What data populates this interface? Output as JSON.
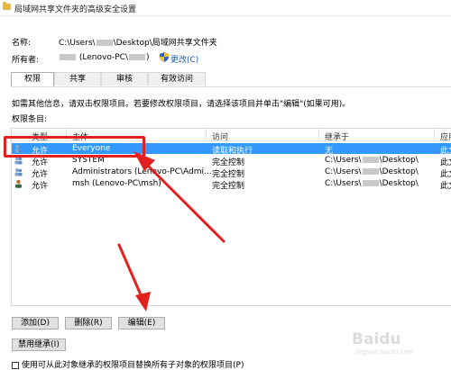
{
  "window": {
    "title": "局域网共享文件夹的高级安全设置"
  },
  "info": {
    "name_label": "名称:",
    "name_prefix": "C:\\Users\\",
    "name_suffix": "\\Desktop\\局域网共享文件夹",
    "owner_label": "所有者:",
    "owner_prefix": "(Lenovo-PC\\",
    "owner_suffix": ")",
    "change_label": "更改(C)"
  },
  "tabs": [
    {
      "label": "权限"
    },
    {
      "label": "共享"
    },
    {
      "label": "审核"
    },
    {
      "label": "有效访问"
    }
  ],
  "hint_text": "如需其他信息，请双击权限项目。若要修改权限项目，请选择该项目并单击\"编辑\"(如果可用)。",
  "entries_label": "权限条目:",
  "grid": {
    "columns": [
      "类型",
      "主体",
      "访问",
      "继承于",
      "应用"
    ],
    "rows": [
      {
        "type": "允许",
        "principal": "Everyone",
        "access": "读取和执行",
        "inherit": "无",
        "inherit_suffix": "",
        "apply": "此文"
      },
      {
        "type": "允许",
        "principal": "SYSTEM",
        "access": "完全控制",
        "inherit": "C:\\Users\\",
        "inherit_suffix": "\\Desktop\\",
        "apply": "此文"
      },
      {
        "type": "允许",
        "principal": "Administrators (Lenovo-PC\\Admi...",
        "access": "完全控制",
        "inherit": "C:\\Users\\",
        "inherit_suffix": "\\Desktop\\",
        "apply": "此文"
      },
      {
        "type": "允许",
        "principal": "msh (Lenovo-PC\\msh)",
        "access": "完全控制",
        "inherit": "C:\\Users\\",
        "inherit_suffix": "\\Desktop\\",
        "apply": "此文"
      }
    ]
  },
  "buttons": {
    "add": "添加(D)",
    "remove": "删除(R)",
    "edit": "编辑(E)",
    "disable_inheritance": "禁用继承(I)"
  },
  "checkbox_label": "使用可从此对象继承的权限项目替换所有子对象的权限项目(P)",
  "watermark": {
    "brand": "Baidu",
    "sub": "jingyan.baidu.com"
  },
  "colors": {
    "selection": "#3399ff",
    "highlight": "#e32020",
    "link": "#1a5fb4"
  }
}
